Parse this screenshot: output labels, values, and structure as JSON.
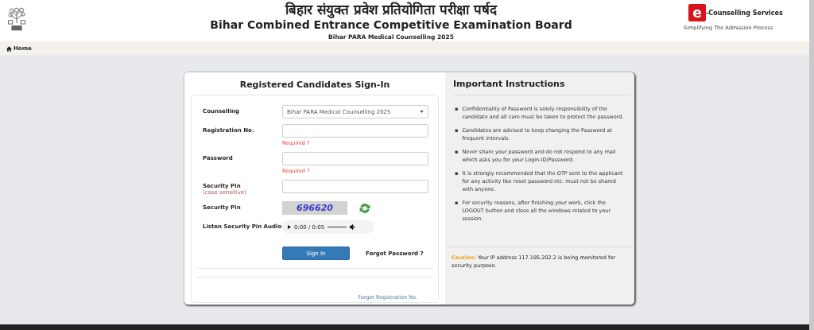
{
  "header": {
    "title_hindi": "बिहार संयुक्त प्रवेश प्रतियोगिता परीक्षा पर्षद",
    "title": "Bihar Combined Entrance Competitive Examination Board",
    "subtitle": "Bihar PARA Medical Counselling 2025",
    "brand_letter": "e",
    "brand_name": "-Counselling Services",
    "brand_tagline": "Simplifying The Admission Process"
  },
  "nav": {
    "home": "Home"
  },
  "signin": {
    "title": "Registered Candidates Sign-In",
    "fields": [
      {
        "kind": "select",
        "label": "Counselling",
        "value": "Bihar PARA Medical Counselling 2025"
      },
      {
        "kind": "input",
        "label": "Registration No.",
        "error": "Required ?"
      },
      {
        "kind": "input",
        "label": "Password",
        "error": "Required ?"
      },
      {
        "kind": "input",
        "label": "Security Pin",
        "hint": "(case sensitive)"
      },
      {
        "kind": "captcha",
        "label": "Security Pin",
        "code": "696620"
      },
      {
        "kind": "audio",
        "label": "Listen Security Pin Audio",
        "time": "0:00 / 0:05"
      }
    ],
    "submit": "Sign In",
    "forgot_password": "Forgot Password ?",
    "forgot_registration": "Forgot Registration No."
  },
  "instructions": {
    "title": "Important Instructions",
    "bullet": "▪",
    "items": [
      "Confidentiality of Password is solely responsibility of the candidate and all care must be taken to protect the password.",
      "Candidates are advised to keep changing the Password at frequent intervals.",
      "Never share your password and do not respond to any mail which asks you for your Login-ID/Password.",
      "It is strongly recommended that the OTP sent to the applicant for any activity like reset password etc. must not be shared with anyone.",
      "For security reasons, after finishing your work, click the LOGOUT button and close all the windows related to your session."
    ],
    "caution": "**Caution:** Your IP address 117.195.202.2 is being monitored for security purpose."
  }
}
